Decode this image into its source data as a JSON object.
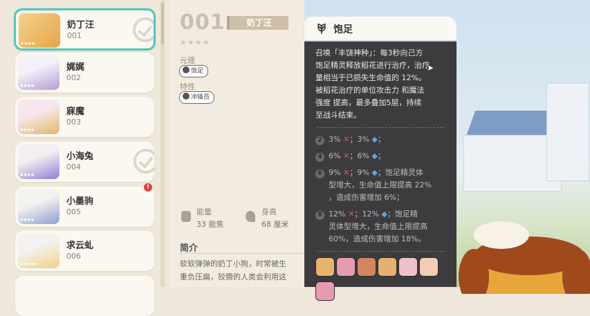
{
  "colors": {
    "accent": "#4cc8b8",
    "alert": "#e2403a",
    "panel_bg": "#3c3c3e"
  },
  "sidebar": {
    "cards": [
      {
        "name": "奶丁汪",
        "number": "001",
        "stars": "★★★★",
        "selected": true,
        "checked": true,
        "alert": false
      },
      {
        "name": "娓娓",
        "number": "002",
        "stars": "★★★★",
        "selected": false,
        "checked": false,
        "alert": false
      },
      {
        "name": "寐魔",
        "number": "003",
        "stars": "★★★★",
        "selected": false,
        "checked": false,
        "alert": false
      },
      {
        "name": "小海兔",
        "number": "004",
        "stars": "★★★★",
        "selected": false,
        "checked": true,
        "alert": false
      },
      {
        "name": "小墨驹",
        "number": "005",
        "stars": "★★★★",
        "selected": false,
        "checked": false,
        "alert": true
      },
      {
        "name": "求云虬",
        "number": "006",
        "stars": "★★★★★",
        "selected": false,
        "checked": false,
        "alert": false
      }
    ],
    "alert_mark": "!"
  },
  "detail": {
    "number": "001",
    "name": "奶丁汪",
    "stars": "★★★★",
    "element_label": "元理",
    "element_chip": "饱足",
    "trait_label": "特性",
    "trait_chip": "冲锋员",
    "energy_label": "能量",
    "energy_value": "33 能焦",
    "height_label": "身高",
    "height_value": "68 厘米",
    "intro_title": "简介",
    "intro_line1": "软软弹弹的奶丁小狗，时常被生",
    "intro_line2": "重负压扁，狡猾的人类会利用这"
  },
  "panel": {
    "title": "饱足",
    "icon": "wheat-icon",
    "desc_line1": "召唤「丰饶神种」：每3秒向己方",
    "desc_line2": "饱足精灵释放稻花进行治疗，治疗",
    "desc_line3": "量相当于已损失生命值的 12%。",
    "desc_line4": "被稻花治疗的单位攻击力 和魔法",
    "desc_line5": "强度 提高，最多叠加5层，持续",
    "desc_line6": "至战斗结束。",
    "levels": [
      {
        "badge": "2",
        "text1": "3%",
        "text2": "；3%",
        "text3": "；",
        "extra": []
      },
      {
        "badge": "4",
        "text1": "6%",
        "text2": "；6%",
        "text3": "；",
        "extra": []
      },
      {
        "badge": "6",
        "text1": "9%",
        "text2": "；9%",
        "text3": "；饱足精灵体",
        "extra": [
          "型增大，生命值上限提高 22%",
          "，造成伤害增加 6%；"
        ]
      },
      {
        "badge": "8",
        "text1": "12%",
        "text2": "；12%",
        "text3": "；饱足精",
        "extra": [
          "灵体型增大，生命值上限提高",
          "60%，造成伤害增加 18%。"
        ]
      }
    ],
    "avatar_colors": [
      "#e6b36a",
      "#e79bb0",
      "#d4855f",
      "#e8b070",
      "#f0c0c8",
      "#f2ccb3",
      "#e79bb0"
    ]
  }
}
